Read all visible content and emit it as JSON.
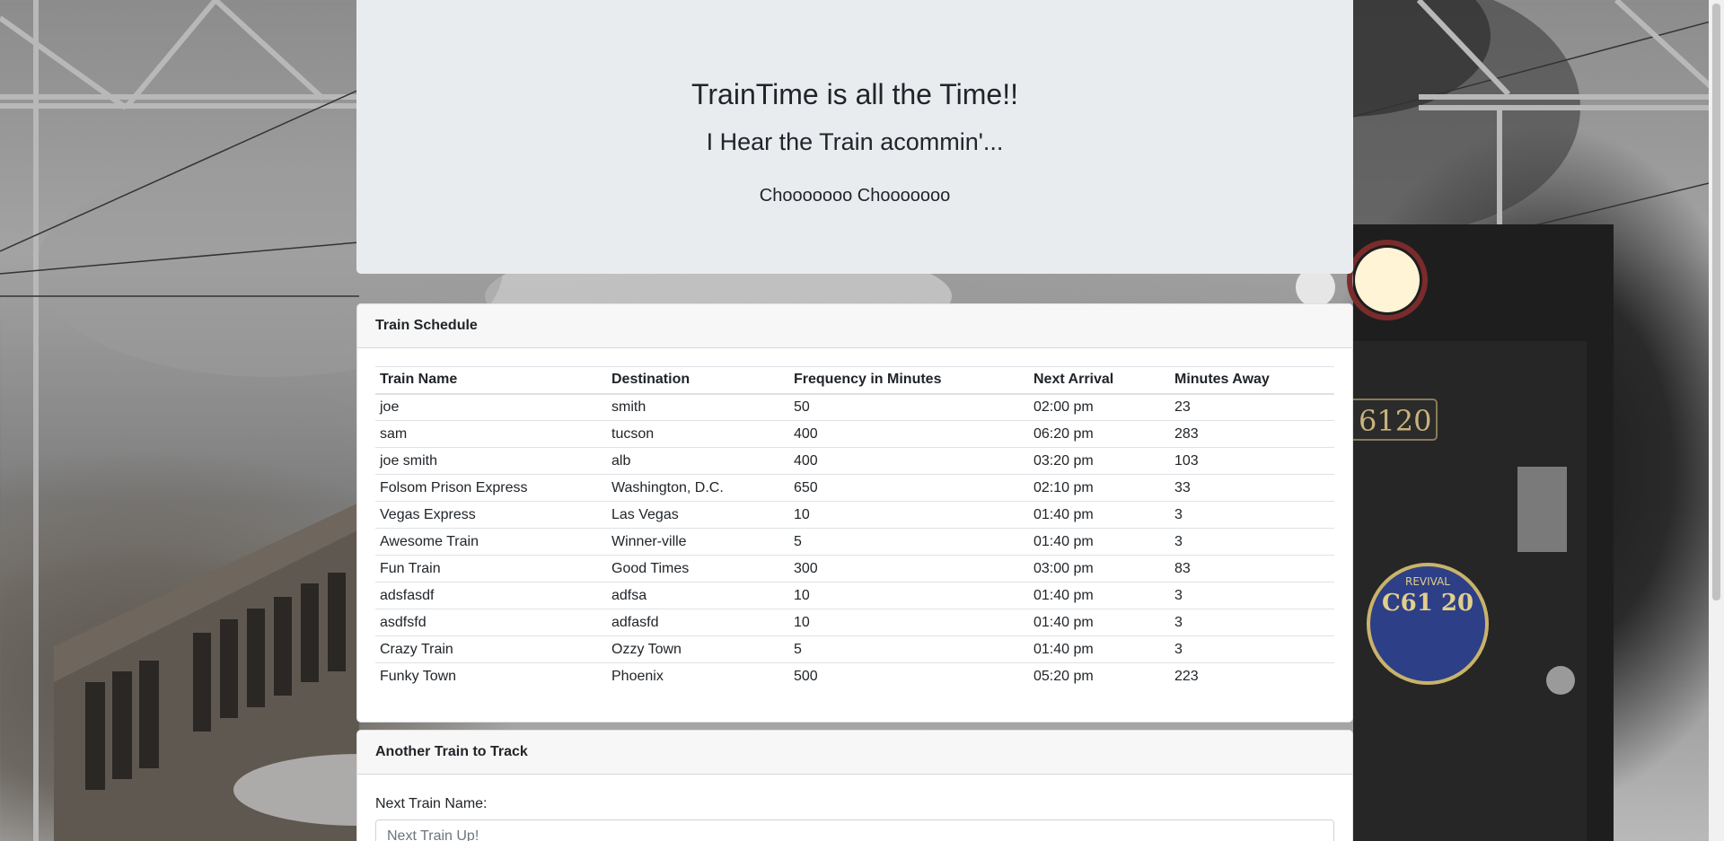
{
  "jumbotron": {
    "title": "TrainTime is all the Time!!",
    "subtitle": "I Hear the Train acommin'...",
    "tagline": "Chooooooo Chooooooo"
  },
  "schedule": {
    "header": "Train Schedule",
    "columns": [
      "Train Name",
      "Destination",
      "Frequency in Minutes",
      "Next Arrival",
      "Minutes Away"
    ],
    "rows": [
      [
        "joe",
        "smith",
        "50",
        "02:00 pm",
        "23"
      ],
      [
        "sam",
        "tucson",
        "400",
        "06:20 pm",
        "283"
      ],
      [
        "joe smith",
        "alb",
        "400",
        "03:20 pm",
        "103"
      ],
      [
        "Folsom Prison Express",
        "Washington, D.C.",
        "650",
        "02:10 pm",
        "33"
      ],
      [
        "Vegas Express",
        "Las Vegas",
        "10",
        "01:40 pm",
        "3"
      ],
      [
        "Awesome Train",
        "Winner-ville",
        "5",
        "01:40 pm",
        "3"
      ],
      [
        "Fun Train",
        "Good Times",
        "300",
        "03:00 pm",
        "83"
      ],
      [
        "adsfasdf",
        "adfsa",
        "10",
        "01:40 pm",
        "3"
      ],
      [
        "asdfsfd",
        "adfasfd",
        "10",
        "01:40 pm",
        "3"
      ],
      [
        "Crazy Train",
        "Ozzy Town",
        "5",
        "01:40 pm",
        "3"
      ],
      [
        "Funky Town",
        "Phoenix",
        "500",
        "05:20 pm",
        "223"
      ]
    ]
  },
  "add_train": {
    "header": "Another Train to Track",
    "name_label": "Next Train Name:",
    "name_placeholder": "Next Train Up!",
    "name_value": ""
  },
  "colors": {
    "jumbotron_bg": "#e9ecef",
    "card_header_bg": "#f7f7f7",
    "text": "#212529"
  }
}
